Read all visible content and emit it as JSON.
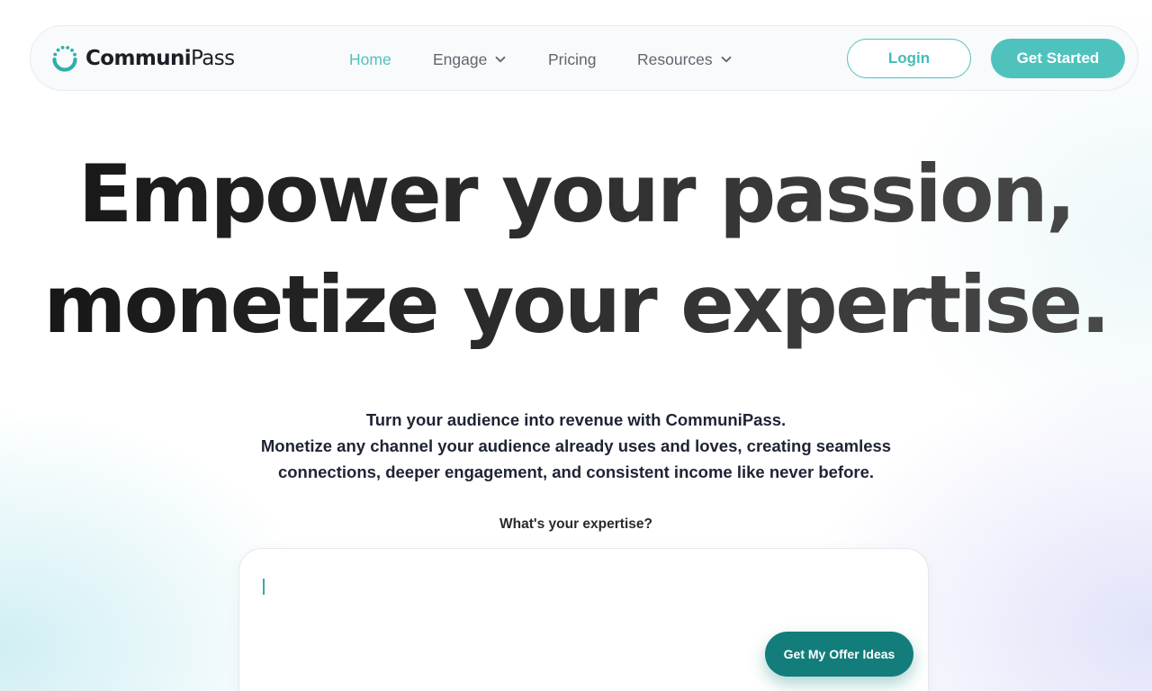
{
  "brand": {
    "name_part1": "Communi",
    "name_part2": "Pass",
    "logo_icon": "dotted-arc-logo-icon",
    "accent_color": "#4fc2be"
  },
  "nav": {
    "items": [
      {
        "label": "Home",
        "active": true
      },
      {
        "label": "Engage",
        "dropdown": true
      },
      {
        "label": "Pricing"
      },
      {
        "label": "Resources",
        "dropdown": true
      }
    ],
    "login_label": "Login",
    "get_started_label": "Get Started"
  },
  "hero": {
    "line1": "Empower your passion,",
    "line2": "monetize your expertise."
  },
  "subtitle": {
    "line1": "Turn your audience into revenue with CommuniPass.",
    "line2": "Monetize any channel your audience already uses and loves, creating seamless",
    "line3": "connections, deeper engagement, and consistent income like never before."
  },
  "expertise": {
    "label": "What's your expertise?",
    "value": "",
    "button_label": "Get My Offer Ideas",
    "button_color": "#137d7b"
  }
}
